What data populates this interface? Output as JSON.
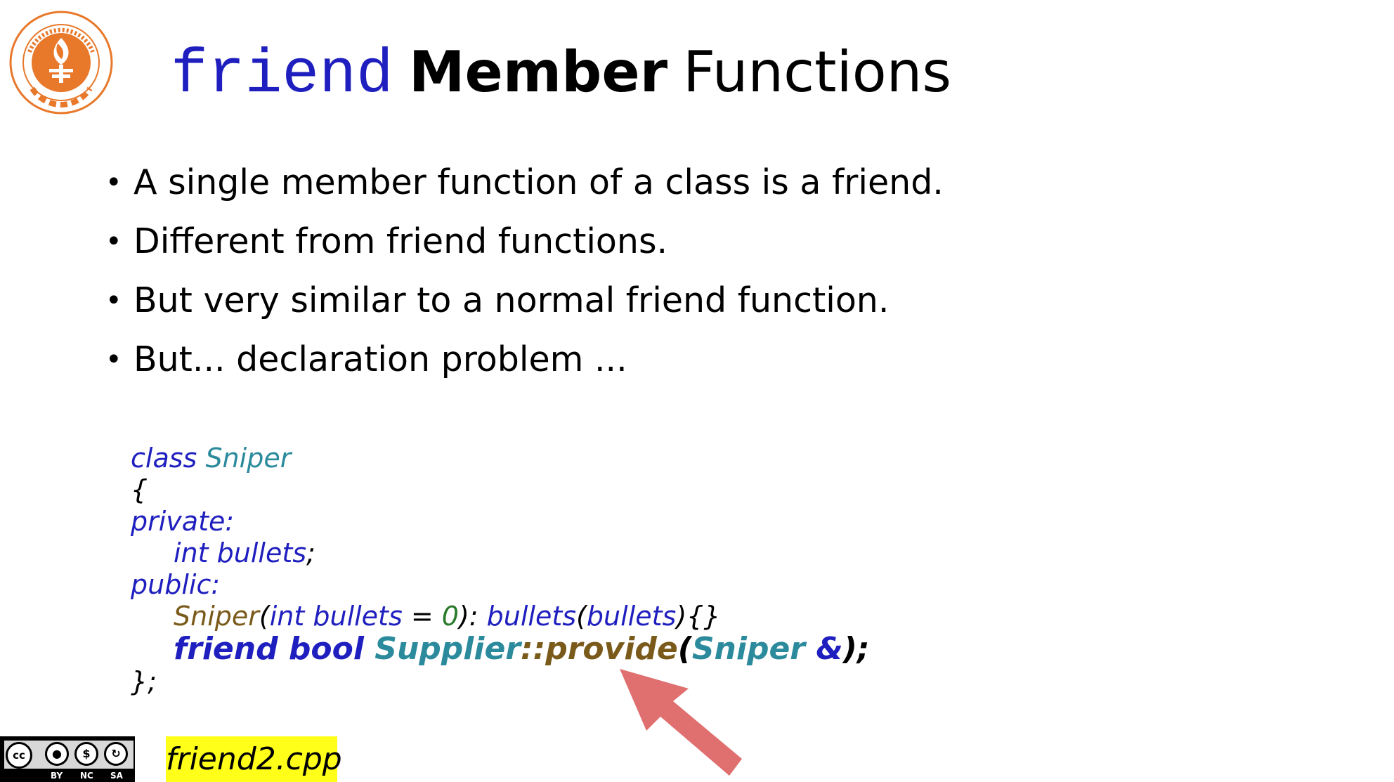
{
  "title": {
    "keyword": "friend",
    "bold": "Member",
    "rest": "Functions"
  },
  "bullets": [
    "A single member function of a class is a friend.",
    "Different from friend functions.",
    "But very similar to a normal friend function.",
    "But... declaration problem ..."
  ],
  "code": {
    "l1": {
      "kw": "class",
      "name": "Sniper"
    },
    "l2": "{",
    "l3": "private:",
    "l4": {
      "kw": "int",
      "var": "bullets",
      "end": ";"
    },
    "l5": "public:",
    "l6": {
      "fn": "Sniper",
      "p1": "(",
      "kw": "int",
      "var": "bullets",
      "eq": " = ",
      "num": "0",
      "p2": "): ",
      "var2": "bullets",
      "p3": "(",
      "var3": "bullets",
      "p4": "){}"
    },
    "l7": {
      "kw1": "friend",
      "kw2": "bool",
      "cls": "Supplier",
      "sep": "::",
      "fn": "provide",
      "p1": "(",
      "type": "Sniper",
      "amp": "&",
      "p2": ");"
    },
    "l8": "};"
  },
  "license": {
    "cc": "cc",
    "labels": [
      "BY",
      "NC",
      "SA"
    ]
  },
  "filename": "friend2.cpp",
  "colors": {
    "keyword_blue": "#1f1fbf",
    "type_teal": "#2b8a9c",
    "function_brown": "#7a5a1a",
    "number_green": "#2a7a2a",
    "logo_orange": "#e8782a",
    "arrow_red": "#e07070",
    "filename_highlight": "#ffff1a"
  }
}
